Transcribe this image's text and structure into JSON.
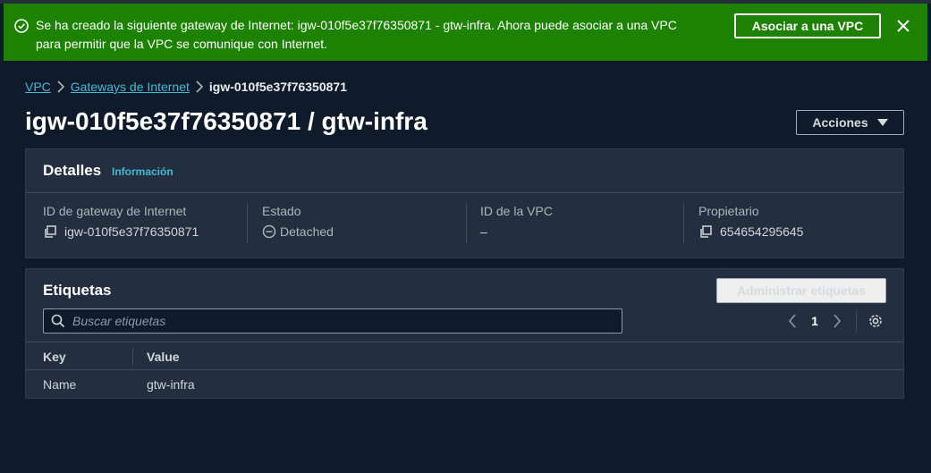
{
  "flash": {
    "message_line1": "Se ha creado la siguiente gateway de Internet: igw-010f5e37f76350871 - gtw-infra. Ahora puede asociar a una VPC",
    "message_line2": "para permitir que la VPC se comunique con Internet.",
    "associate_label": "Asociar a una VPC",
    "color": "#1d8102"
  },
  "breadcrumb": {
    "items": [
      "VPC",
      "Gateways de Internet",
      "igw-010f5e37f76350871"
    ]
  },
  "page": {
    "title": "igw-010f5e37f76350871 / gtw-infra",
    "actions_label": "Acciones"
  },
  "details": {
    "title": "Detalles",
    "info_link": "Información",
    "fields": [
      {
        "label": "ID de gateway de Internet",
        "value": "igw-010f5e37f76350871",
        "icon": "copy-icon"
      },
      {
        "label": "Estado",
        "value": "Detached",
        "icon": "detached-icon"
      },
      {
        "label": "ID de la VPC",
        "value": "–"
      },
      {
        "label": "Propietario",
        "value": "654654295645",
        "icon": "copy-icon"
      }
    ]
  },
  "tags": {
    "title": "Etiquetas",
    "manage_label": "Administrar etiquetas",
    "search_placeholder": "Buscar etiquetas",
    "page": "1",
    "columns": [
      "Key",
      "Value"
    ],
    "rows": [
      {
        "key": "Name",
        "value": "gtw-infra"
      }
    ]
  },
  "colors": {
    "link": "#44b9d6",
    "background": "#0f1b2a",
    "panel": "#232f3e"
  }
}
